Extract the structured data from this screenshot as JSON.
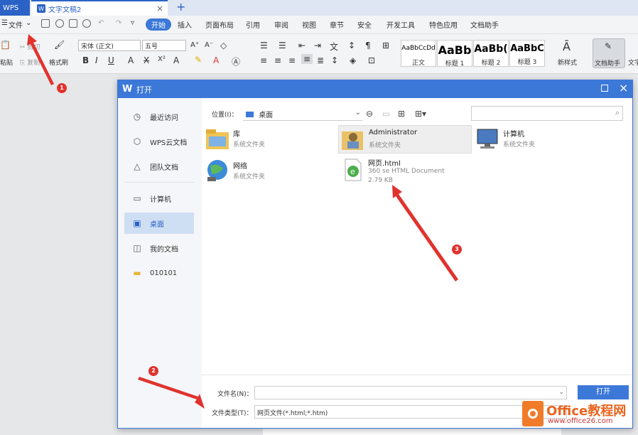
{
  "tabs": {
    "wps": "WPS",
    "doc": "文字文稿2",
    "close": "×",
    "add": "+"
  },
  "menu": {
    "file": "文件",
    "items": [
      "开始",
      "插入",
      "页面布局",
      "引用",
      "审阅",
      "视图",
      "章节",
      "安全",
      "开发工具",
      "特色应用",
      "文档助手"
    ]
  },
  "ribbon": {
    "paste": "粘贴",
    "cut": "剪切",
    "copy": "复制",
    "format_painter": "格式刷",
    "font_name": "宋体 (正文)",
    "font_size": "五号",
    "styles": [
      {
        "preview": "AaBbCcDd",
        "label": "正文"
      },
      {
        "preview": "AaBb",
        "label": "标题 1"
      },
      {
        "preview": "AaBb(",
        "label": "标题 2"
      },
      {
        "preview": "AaBbC",
        "label": "标题 3"
      }
    ],
    "new_style": "新样式",
    "doc_helper": "文档助手",
    "text_tool": "文字"
  },
  "dialog": {
    "title": "打开",
    "sidebar": [
      {
        "icon": "clock-icon",
        "glyph": "◷",
        "label": "最近访问"
      },
      {
        "icon": "cube-icon",
        "glyph": "⬡",
        "label": "WPS云文档"
      },
      {
        "icon": "team-icon",
        "glyph": "△",
        "label": "团队文档"
      },
      {
        "icon": "computer-icon",
        "glyph": "▭",
        "label": "计算机"
      },
      {
        "icon": "desktop-icon",
        "glyph": "▣",
        "label": "桌面"
      },
      {
        "icon": "my-docs-icon",
        "glyph": "◫",
        "label": "我的文档"
      },
      {
        "icon": "folder-icon",
        "glyph": "▬",
        "label": "010101"
      }
    ],
    "location_label": "位置(I)：",
    "location_value": "桌面",
    "files": [
      {
        "name": "库",
        "sub": "系统文件夹",
        "sub2": ""
      },
      {
        "name": "Administrator",
        "sub": "系统文件夹",
        "sub2": ""
      },
      {
        "name": "计算机",
        "sub": "系统文件夹",
        "sub2": ""
      },
      {
        "name": "网络",
        "sub": "系统文件夹",
        "sub2": ""
      },
      {
        "name": "网页.html",
        "sub": "360 se HTML Document",
        "sub2": "2.79 KB"
      }
    ],
    "filename_label": "文件名(N)：",
    "filename_value": "",
    "filetype_label": "文件类型(T)：",
    "filetype_value": "网页文件(*.html;*.htm)",
    "open_button": "打开"
  },
  "annotations": [
    "1",
    "2",
    "3"
  ],
  "watermark": {
    "title": "Office教程网",
    "url": "www.office26.com"
  },
  "colors": {
    "accent": "#3c78d8",
    "annotation": "#e0332e",
    "watermark": "#e8641e"
  }
}
